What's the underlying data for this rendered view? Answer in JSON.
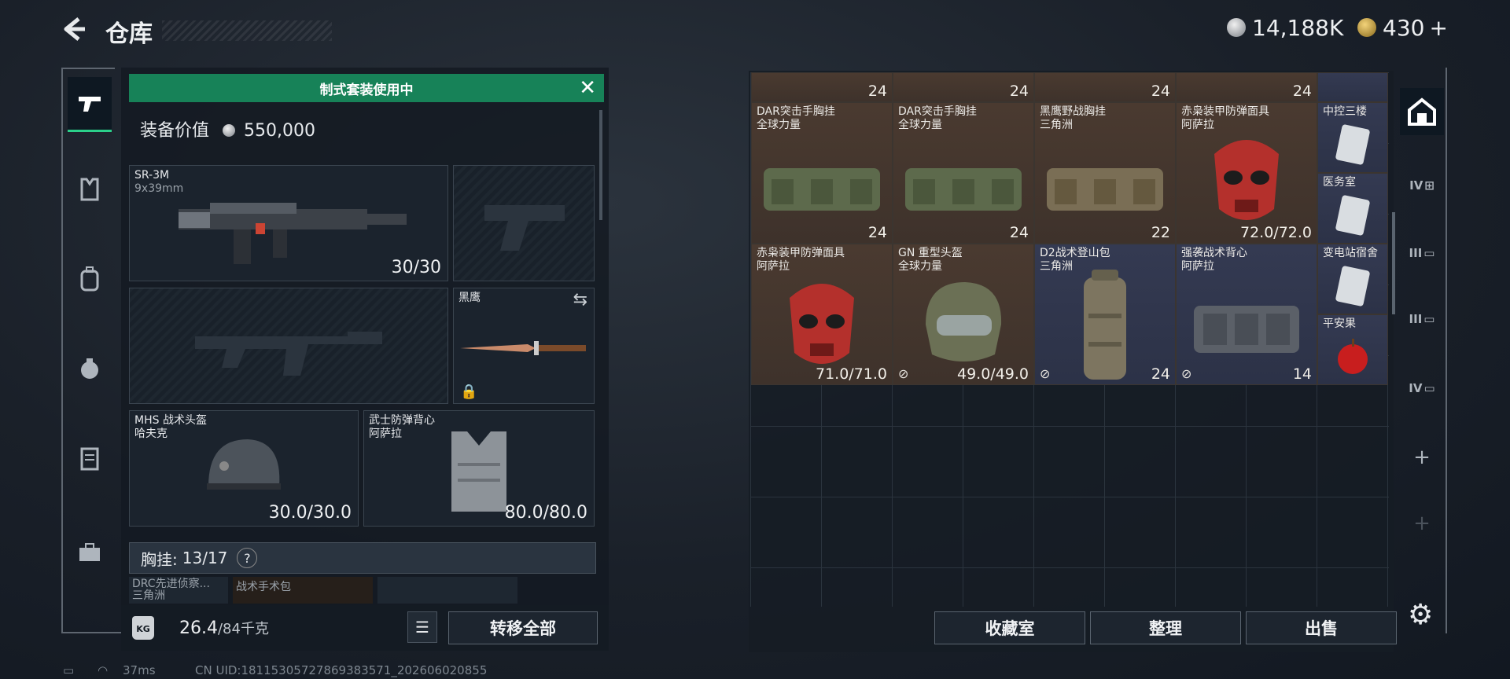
{
  "header": {
    "back_icon": "back-arrow-icon",
    "title": "仓库",
    "currency_silver": "14,188K",
    "currency_gold": "430",
    "gold_add": "+"
  },
  "left_nav": {
    "tabs": [
      {
        "icon": "pistol-icon"
      },
      {
        "icon": "vest-icon"
      },
      {
        "icon": "backpack-icon"
      },
      {
        "icon": "bag-icon"
      },
      {
        "icon": "case-icon"
      },
      {
        "icon": "toolbox-icon"
      }
    ]
  },
  "loadout": {
    "banner": "制式套装使用中",
    "equip_value_label": "装备价值",
    "equip_value": "550,000",
    "primary": {
      "name": "SR-3M",
      "ammo": "9x39mm",
      "count": "30/30"
    },
    "melee": {
      "name": "黑鹰"
    },
    "helmet": {
      "name": "MHS 战术头盔",
      "sub": "哈夫克",
      "durability": "30.0/30.0"
    },
    "armor": {
      "name": "武士防弹背心",
      "sub": "阿萨拉",
      "durability": "80.0/80.0"
    },
    "chest_label": "胸挂:",
    "chest_value": "13/17",
    "chest_help": "?",
    "chest_items": [
      "DRC先进侦察...",
      "战术手术包"
    ],
    "chest_item_sub": "三角洲",
    "weight": "26.4",
    "weight_max": "/84千克",
    "transfer_all": "转移全部"
  },
  "storage": {
    "top_counts": [
      "24",
      "24",
      "24",
      "24"
    ],
    "row1": [
      {
        "name": "DAR突击手胸挂",
        "sub": "全球力量",
        "count": "24"
      },
      {
        "name": "DAR突击手胸挂",
        "sub": "全球力量",
        "count": "24"
      },
      {
        "name": "黑鹰野战胸挂",
        "sub": "三角洲",
        "count": "22"
      },
      {
        "name": "赤枭装甲防弹面具",
        "sub": "阿萨拉",
        "durability": "72.0/72.0"
      }
    ],
    "row2": [
      {
        "name": "赤枭装甲防弹面具",
        "sub": "阿萨拉",
        "durability": "71.0/71.0"
      },
      {
        "name": "GN 重型头盔",
        "sub": "全球力量",
        "durability": "49.0/49.0"
      },
      {
        "name": "D2战术登山包",
        "sub": "三角洲",
        "count": "24"
      },
      {
        "name": "强袭战术背心",
        "sub": "阿萨拉",
        "count": "14"
      }
    ],
    "keys": [
      "中控三楼",
      "医务室",
      "变电站宿舍",
      "平安果"
    ],
    "buttons": {
      "collection": "收藏室",
      "sort": "整理",
      "sell": "出售"
    }
  },
  "right_nav": {
    "tabs": [
      "IV",
      "III",
      "IV"
    ],
    "add": "+"
  },
  "status_bar": {
    "ping": "37ms",
    "uid": "CN UID:18115305727869383571_202606020855"
  },
  "colors": {
    "accent_green": "#178258",
    "cell_brown": "#4a3a30",
    "cell_blue": "#343a52"
  }
}
